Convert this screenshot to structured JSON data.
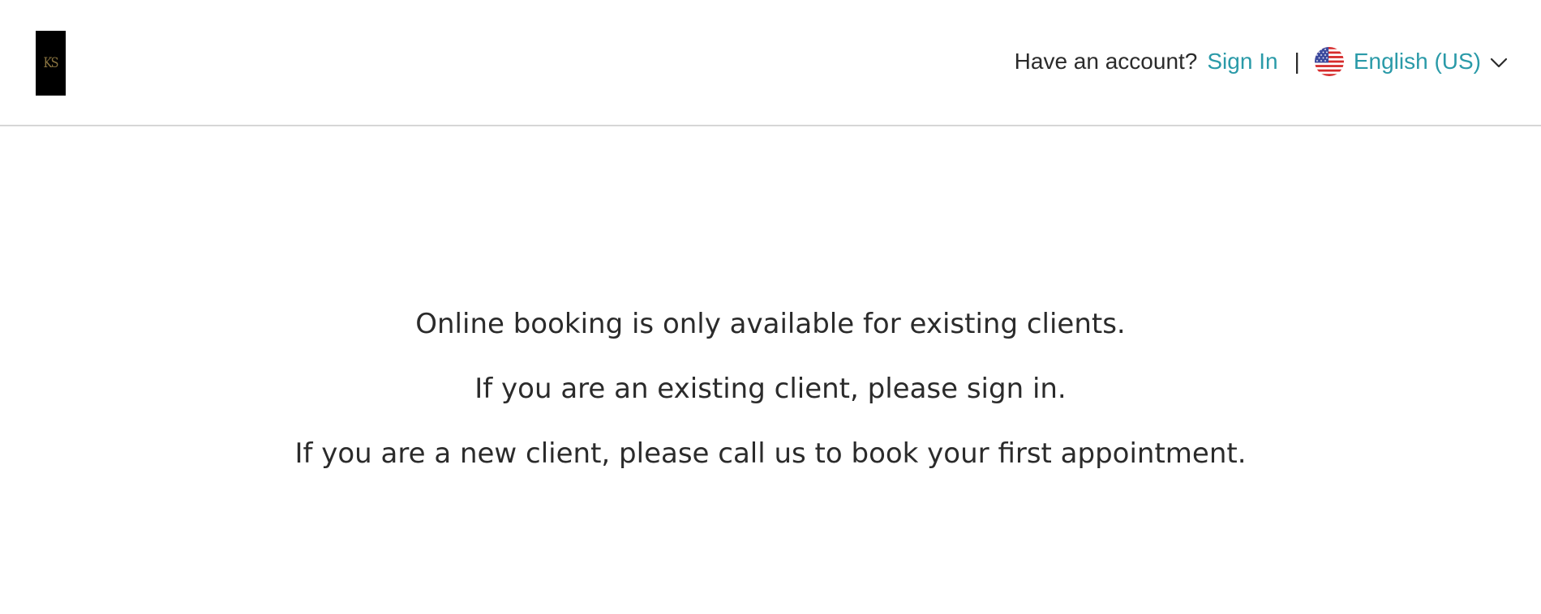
{
  "header": {
    "logo_text": "KS",
    "have_account": "Have an account?",
    "sign_in": "Sign In",
    "divider": "|",
    "language": "English (US)",
    "flag_icon": "us-flag-icon",
    "chevron_icon": "chevron-down-icon"
  },
  "main": {
    "line1": "Online booking is only available for existing clients.",
    "line2": "If you are an existing client, please sign in.",
    "line3": "If you are a new client, please call us to book your first appointment."
  },
  "colors": {
    "link": "#2a9aa8",
    "text": "#2b2b2b",
    "divider": "#d6d6d6"
  }
}
